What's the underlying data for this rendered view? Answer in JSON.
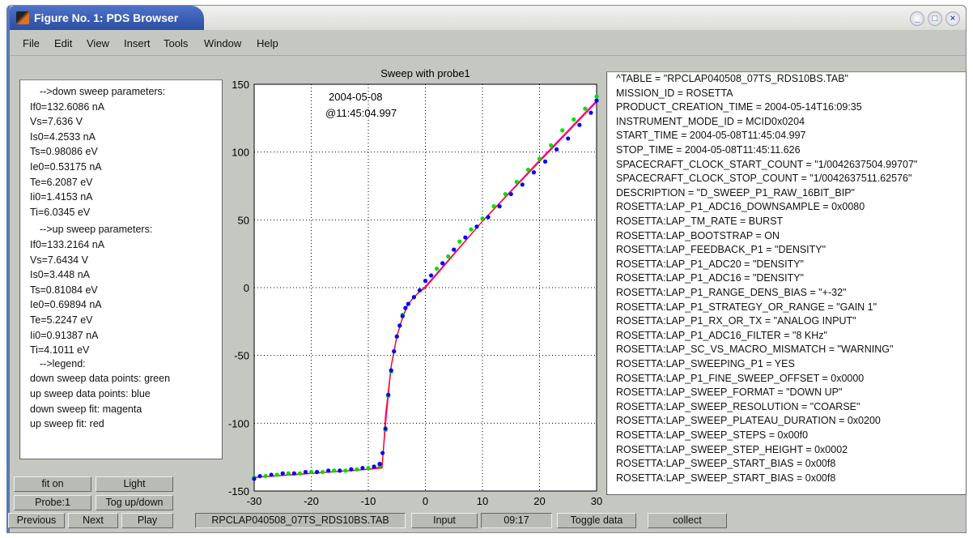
{
  "window": {
    "title": "Figure No. 1: PDS Browser",
    "controls": [
      "minimize",
      "maximize",
      "close"
    ]
  },
  "menu": [
    "File",
    "Edit",
    "View",
    "Insert",
    "Tools",
    "Window",
    "Help"
  ],
  "left_panel": [
    "-->down sweep parameters:",
    "If0=132.6086 nA",
    "Vs=7.636 V",
    "Is0=4.2533 nA",
    "Ts=0.98086 eV",
    "Ie0=0.53175 nA",
    "Te=6.2087 eV",
    "Ii0=1.4153 nA",
    "Ti=6.0345 eV",
    "-->up sweep parameters:",
    "If0=133.2164 nA",
    "Vs=7.6434 V",
    "Is0=3.448 nA",
    "Ts=0.81084 eV",
    "Ie0=0.69894 nA",
    "Te=5.2247 eV",
    "Ii0=0.91387 nA",
    "Ti=4.1011 eV",
    "-->legend:",
    "down sweep data points: green",
    "up sweep data points: blue",
    "down sweep fit: magenta",
    "up sweep fit: red"
  ],
  "right_panel": [
    "^TABLE = \"RPCLAP040508_07TS_RDS10BS.TAB\"",
    "MISSION_ID = ROSETTA",
    "PRODUCT_CREATION_TIME = 2004-05-14T16:09:35",
    "INSTRUMENT_MODE_ID = MCID0x0204",
    "START_TIME = 2004-05-08T11:45:04.997",
    "STOP_TIME = 2004-05-08T11:45:11.626",
    "SPACECRAFT_CLOCK_START_COUNT = \"1/0042637504.99707\"",
    "SPACECRAFT_CLOCK_STOP_COUNT = \"1/0042637511.62576\"",
    "DESCRIPTION = \"D_SWEEP_P1_RAW_16BIT_BIP\"",
    "ROSETTA:LAP_P1_ADC16_DOWNSAMPLE = 0x0080",
    "ROSETTA:LAP_TM_RATE = BURST",
    "ROSETTA:LAP_BOOTSTRAP = ON",
    "ROSETTA:LAP_FEEDBACK_P1 = \"DENSITY\"",
    "ROSETTA:LAP_P1_ADC20 = \"DENSITY\"",
    "ROSETTA:LAP_P1_ADC16 = \"DENSITY\"",
    "ROSETTA:LAP_P1_RANGE_DENS_BIAS = \"+-32\"",
    "ROSETTA:LAP_P1_STRATEGY_OR_RANGE = \"GAIN 1\"",
    "ROSETTA:LAP_P1_RX_OR_TX = \"ANALOG INPUT\"",
    "ROSETTA:LAP_P1_ADC16_FILTER = \"8 KHz\"",
    "ROSETTA:LAP_SC_VS_MACRO_MISMATCH = \"WARNING\"",
    "ROSETTA:LAP_SWEEPING_P1 = YES",
    "ROSETTA:LAP_P1_FINE_SWEEP_OFFSET = 0x0000",
    "ROSETTA:LAP_SWEEP_FORMAT = \"DOWN UP\"",
    "ROSETTA:LAP_SWEEP_RESOLUTION = \"COARSE\"",
    "ROSETTA:LAP_SWEEP_PLATEAU_DURATION = 0x0200",
    "ROSETTA:LAP_SWEEP_STEPS = 0x00f0",
    "ROSETTA:LAP_SWEEP_STEP_HEIGHT = 0x0002",
    "ROSETTA:LAP_SWEEP_START_BIAS = 0x00f8",
    "ROSETTA:LAP_SWEEP_START_BIAS = 0x00f8"
  ],
  "buttons": {
    "fit_on": "fit on",
    "light": "Light",
    "probe": "Probe:1",
    "tog_up_down": "Tog up/down",
    "previous": "Previous",
    "next": "Next",
    "play": "Play",
    "input": "Input",
    "toggle_data": "Toggle data",
    "collect": "collect"
  },
  "fields": {
    "filename": "RPCLAP040508_07TS_RDS10BS.TAB",
    "time": "09:17"
  },
  "chart_data": {
    "type": "scatter",
    "title": "Sweep with probe1",
    "annotation": [
      "2004-05-08",
      "@11:45:04.997"
    ],
    "xlim": [
      -30,
      30
    ],
    "ylim": [
      -150,
      150
    ],
    "xticks": [
      -30,
      -20,
      -10,
      0,
      10,
      20,
      30
    ],
    "yticks": [
      -150,
      -100,
      -50,
      0,
      50,
      100,
      150
    ],
    "grid": true,
    "series": [
      {
        "name": "down sweep data points",
        "color": "#00e000",
        "kind": "points",
        "x": [
          -30,
          -28,
          -26,
          -24,
          -22,
          -20,
          -18,
          -16,
          -14,
          -12,
          -10,
          -8,
          -7,
          -6.5,
          -6,
          -5.5,
          -5,
          -4.5,
          -4,
          -3,
          -2,
          -1,
          0,
          2,
          4,
          6,
          8,
          10,
          12,
          14,
          16,
          18,
          20,
          22,
          24,
          26,
          28,
          30
        ],
        "y": [
          -140,
          -139,
          -138,
          -137,
          -137,
          -136,
          -136,
          -135,
          -135,
          -134,
          -133,
          -131,
          -105,
          -80,
          -62,
          -47,
          -36,
          -28,
          -20,
          -12,
          -7,
          -2,
          5,
          14,
          23,
          34,
          43,
          51,
          60,
          69,
          78,
          87,
          95,
          105,
          116,
          124,
          132,
          141
        ]
      },
      {
        "name": "up sweep data points",
        "color": "#0000ff",
        "kind": "points",
        "x": [
          -30,
          -29,
          -27,
          -25,
          -23,
          -21,
          -19,
          -17,
          -15,
          -13,
          -11,
          -9,
          -8,
          -7.5,
          -7,
          -6.5,
          -6,
          -5.5,
          -5,
          -4.5,
          -4,
          -3.5,
          -3,
          -2,
          -1,
          0,
          1,
          3,
          5,
          7,
          9,
          11,
          13,
          15,
          17,
          19,
          21,
          23,
          25,
          27,
          29,
          30
        ],
        "y": [
          -141,
          -139,
          -138,
          -137,
          -137,
          -136,
          -136,
          -135,
          -135,
          -134,
          -133,
          -132,
          -130,
          -122,
          -104,
          -79,
          -61,
          -47,
          -36,
          -28,
          -21,
          -15,
          -12,
          -7,
          -2,
          5,
          9,
          18,
          28,
          37,
          45,
          52,
          60,
          69,
          76,
          85,
          93,
          102,
          110,
          120,
          129,
          138
        ]
      },
      {
        "name": "down sweep fit",
        "color": "#ff00ff",
        "kind": "line",
        "x": [
          -30,
          -20,
          -10,
          -7.6,
          -7,
          -6,
          -5,
          -4,
          -3,
          -2,
          -1,
          0,
          10,
          20,
          30
        ],
        "y": [
          -140,
          -137,
          -134,
          -132,
          -102,
          -58,
          -36,
          -22,
          -12,
          -7,
          -3,
          1,
          49,
          94,
          138
        ]
      },
      {
        "name": "up sweep fit",
        "color": "#ff0000",
        "kind": "line",
        "x": [
          -30,
          -20,
          -10,
          -7.6,
          -7.2,
          -7,
          -6,
          -5,
          -4,
          -3,
          -2,
          -1,
          0,
          10,
          20,
          30
        ],
        "y": [
          -140,
          -137,
          -134,
          -133,
          -110,
          -95,
          -58,
          -36,
          -22,
          -12,
          -7,
          -3,
          0,
          49,
          93,
          137
        ]
      }
    ]
  }
}
